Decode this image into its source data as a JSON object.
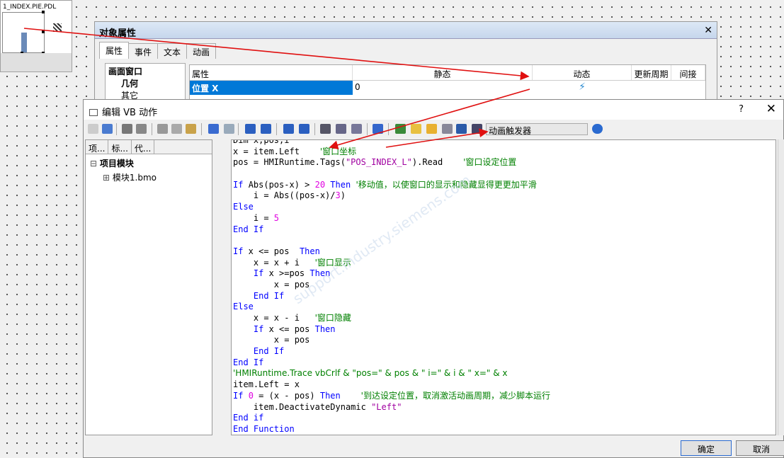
{
  "picture_window": {
    "caption": "1_INDEX.PIE.PDL"
  },
  "props_dialog": {
    "title": "对象属性",
    "tabs": [
      "属性",
      "事件",
      "文本",
      "动画"
    ],
    "tree": {
      "root": "画面窗口",
      "child1": "几何",
      "child2": "其它"
    },
    "grid_headers": [
      "属性",
      "静态",
      "动态",
      "更新周期",
      "间接"
    ],
    "row": {
      "name": "位置 X",
      "static": "0"
    }
  },
  "vb_editor": {
    "title": "编辑 VB 动作",
    "help": "?",
    "close": "✕",
    "trigger_label": "动画触发器",
    "side_tabs": [
      "项...",
      "标...",
      "代..."
    ],
    "tree": {
      "root": "项目模块",
      "module": "模块1.bmo"
    },
    "code": [
      [
        [
          "Dim x,pos,i",
          "k"
        ]
      ],
      [
        [
          "x = item.Left    ",
          "k"
        ],
        [
          "'窗口坐标",
          "c"
        ]
      ],
      [
        [
          "pos = HMIRuntime.Tags(",
          "k"
        ],
        [
          "\"POS_INDEX_L\"",
          "s"
        ],
        [
          ").Read    ",
          "k"
        ],
        [
          "'窗口设定位置",
          "c"
        ]
      ],
      [],
      [
        [
          "If ",
          "b"
        ],
        [
          "Abs(pos-x) > ",
          "k"
        ],
        [
          "20",
          "n"
        ],
        [
          " ",
          "k"
        ],
        [
          "Then",
          "b"
        ],
        [
          " ",
          "k"
        ],
        [
          "'移动值，以使窗口的显示和隐藏显得更更加平滑",
          "c"
        ]
      ],
      [
        [
          "    i = Abs((pos-x)/",
          "k"
        ],
        [
          "3",
          "n"
        ],
        [
          ")",
          "k"
        ]
      ],
      [
        [
          "Else",
          "b"
        ]
      ],
      [
        [
          "    i = ",
          "k"
        ],
        [
          "5",
          "n"
        ]
      ],
      [
        [
          "End If",
          "b"
        ]
      ],
      [],
      [
        [
          "If",
          "b"
        ],
        [
          " x <= pos  ",
          "k"
        ],
        [
          "Then",
          "b"
        ]
      ],
      [
        [
          "    x = x + i   ",
          "k"
        ],
        [
          "'窗口显示",
          "c"
        ]
      ],
      [
        [
          "    ",
          "k"
        ],
        [
          "If",
          "b"
        ],
        [
          " x >=pos ",
          "k"
        ],
        [
          "Then",
          "b"
        ]
      ],
      [
        [
          "        x = pos",
          "k"
        ]
      ],
      [
        [
          "    ",
          "k"
        ],
        [
          "End If",
          "b"
        ]
      ],
      [
        [
          "Else",
          "b"
        ]
      ],
      [
        [
          "    x = x - i   ",
          "k"
        ],
        [
          "'窗口隐藏",
          "c"
        ]
      ],
      [
        [
          "    ",
          "k"
        ],
        [
          "If",
          "b"
        ],
        [
          " x <= pos ",
          "k"
        ],
        [
          "Then",
          "b"
        ]
      ],
      [
        [
          "        x = pos",
          "k"
        ]
      ],
      [
        [
          "    ",
          "k"
        ],
        [
          "End If",
          "b"
        ]
      ],
      [
        [
          "End If",
          "b"
        ]
      ],
      [
        [
          "'HMIRuntime.Trace vbCrlf & \"pos=\" & pos & \" i=\" & i & \" x=\" & x",
          "c"
        ]
      ],
      [
        [
          "item.Left = x",
          "k"
        ]
      ],
      [
        [
          "If ",
          "b"
        ],
        [
          "0",
          "n"
        ],
        [
          " = (x - pos) ",
          "k"
        ],
        [
          "Then",
          "b"
        ],
        [
          "    ",
          "k"
        ],
        [
          "'到达设定位置，取消激活动画周期，减少脚本运行",
          "c"
        ]
      ],
      [
        [
          "    item.DeactivateDynamic ",
          "k"
        ],
        [
          "\"Left\"",
          "s"
        ]
      ],
      [
        [
          "End if",
          "b"
        ]
      ],
      [
        [
          "End Function",
          "b"
        ]
      ]
    ],
    "ok": "确定",
    "cancel": "取消"
  },
  "colors": {
    "keyword": "#0000ff",
    "comment": "#008000",
    "string": "#a000a0",
    "number": "#e000e0",
    "arrow": "#e01010"
  },
  "watermark": "support.industry.siemens.com"
}
